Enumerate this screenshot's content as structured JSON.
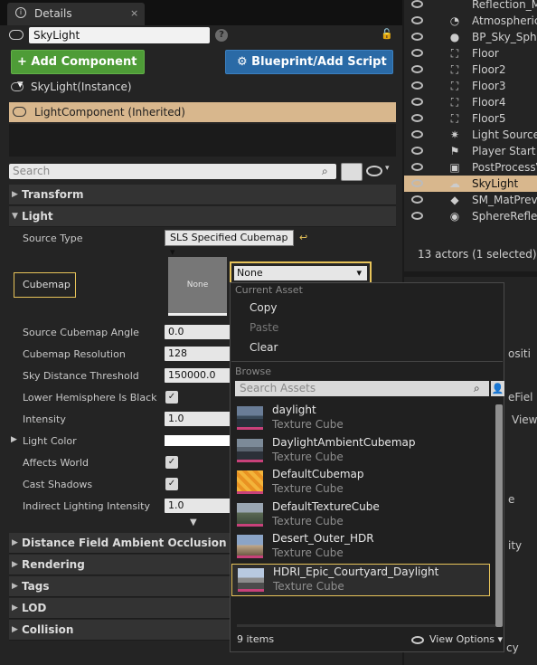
{
  "details_tab": {
    "title": "Details",
    "close": "×"
  },
  "actor_name": "SkyLight",
  "help_glyph": "?",
  "toolbar": {
    "add_component": "+ Add Component ▾",
    "blueprint": "⚙ Blueprint/Add Script"
  },
  "components": {
    "instance": "SkyLight(Instance)",
    "light_component": "LightComponent (Inherited)"
  },
  "search": {
    "placeholder": "Search"
  },
  "categories": {
    "transform": "Transform",
    "light": "Light",
    "dfao": "Distance Field Ambient Occlusion",
    "rendering": "Rendering",
    "tags": "Tags",
    "lod": "LOD",
    "collision": "Collision"
  },
  "properties": {
    "source_type_label": "Source Type",
    "source_type_value": "SLS Specified Cubemap",
    "cubemap_label": "Cubemap",
    "cubemap_thumb": "None",
    "cubemap_value": "None",
    "source_cubemap_angle_label": "Source Cubemap Angle",
    "source_cubemap_angle_value": "0.0",
    "cubemap_resolution_label": "Cubemap Resolution",
    "cubemap_resolution_value": "128",
    "sky_distance_label": "Sky Distance Threshold",
    "sky_distance_value": "150000.0",
    "lower_hemi_label": "Lower Hemisphere Is Black",
    "intensity_label": "Intensity",
    "intensity_value": "1.0",
    "light_color_label": "Light Color",
    "affects_world_label": "Affects World",
    "cast_shadows_label": "Cast Shadows",
    "indirect_label": "Indirect Lighting Intensity",
    "indirect_value": "1.0",
    "check": "✓"
  },
  "popup": {
    "current_asset": "Current Asset",
    "copy": "Copy",
    "paste": "Paste",
    "clear": "Clear",
    "browse": "Browse",
    "search_placeholder": "Search Assets",
    "assets": [
      {
        "name": "daylight",
        "type": "Texture Cube"
      },
      {
        "name": "DaylightAmbientCubemap",
        "type": "Texture Cube"
      },
      {
        "name": "DefaultCubemap",
        "type": "Texture Cube"
      },
      {
        "name": "DefaultTextureCube",
        "type": "Texture Cube"
      },
      {
        "name": "Desert_Outer_HDR",
        "type": "Texture Cube"
      },
      {
        "name": "HDRI_Epic_Courtyard_Daylight",
        "type": "Texture Cube"
      }
    ],
    "count": "9 items",
    "view_options": "View Options ▾"
  },
  "outliner": {
    "rows": [
      "Reflection_Map",
      "Atmospheric",
      "BP_Sky_Sphere",
      "Floor",
      "Floor2",
      "Floor3",
      "Floor4",
      "Floor5",
      "Light Source",
      "Player Start",
      "PostProcessV",
      "SkyLight",
      "SM_MatPrevi",
      "SphereReflect"
    ],
    "status": "13 actors (1 selected)"
  },
  "right_lower": {
    "frag1": "ositi",
    "frag2": "eFiel",
    "frag3": "View",
    "frag4": "e",
    "frag5": "ity",
    "frag6": "cy"
  },
  "colors": {
    "accent_selection": "#d8b78d",
    "highlight_border": "#e8c45a",
    "add_green": "#4e9c37",
    "blueprint_blue": "#2a6aa6"
  }
}
